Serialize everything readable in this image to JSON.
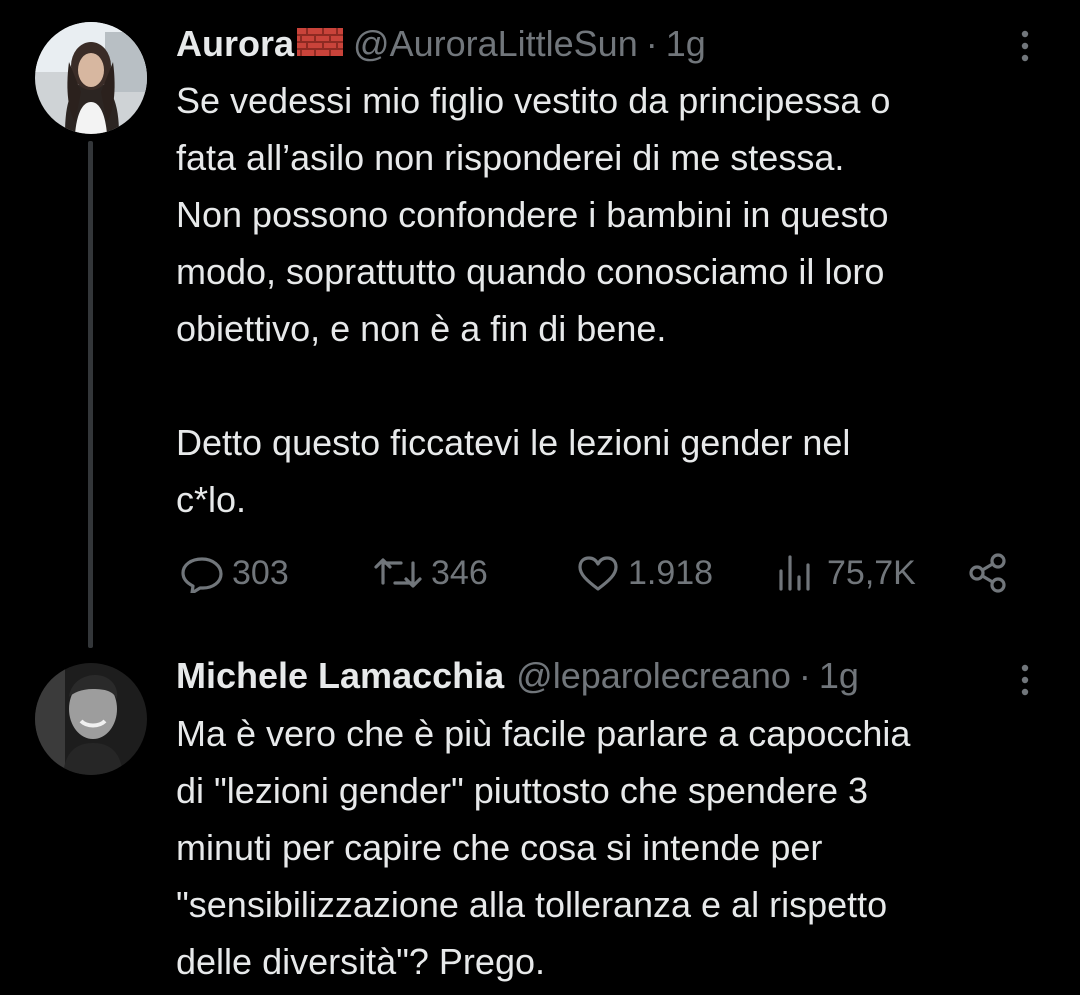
{
  "colors": {
    "background": "#000000",
    "text_primary": "#e7e9ea",
    "text_secondary": "#71767b",
    "thread_line": "#333639"
  },
  "tweets": [
    {
      "display_name": "Aurora",
      "name_emoji": "brick-flag-icon",
      "handle": "@AuroraLittleSun",
      "separator": "·",
      "time": "1g",
      "text": "Se vedessi mio figlio vestito da principessa o\nfata all’asilo non risponderei di me stessa.\nNon possono confondere i bambini in questo\nmodo, soprattutto quando conosciamo il loro\nobiettivo, e non è a fin di bene.\n\nDetto questo ficcatevi le lezioni gender nel\nc*lo.",
      "actions": {
        "replies": "303",
        "retweets": "346",
        "likes": "1.918",
        "views": "75,7K"
      }
    },
    {
      "display_name": "Michele Lamacchia",
      "handle": "@leparolecreano",
      "separator": "·",
      "time": "1g",
      "text": "Ma è vero che è più facile parlare a capocchia\ndi \"lezioni gender\" piuttosto che spendere 3\nminuti per capire che cosa si intende per\n\"sensibilizzazione alla tolleranza e al rispetto\ndelle diversità\"? Prego."
    }
  ]
}
